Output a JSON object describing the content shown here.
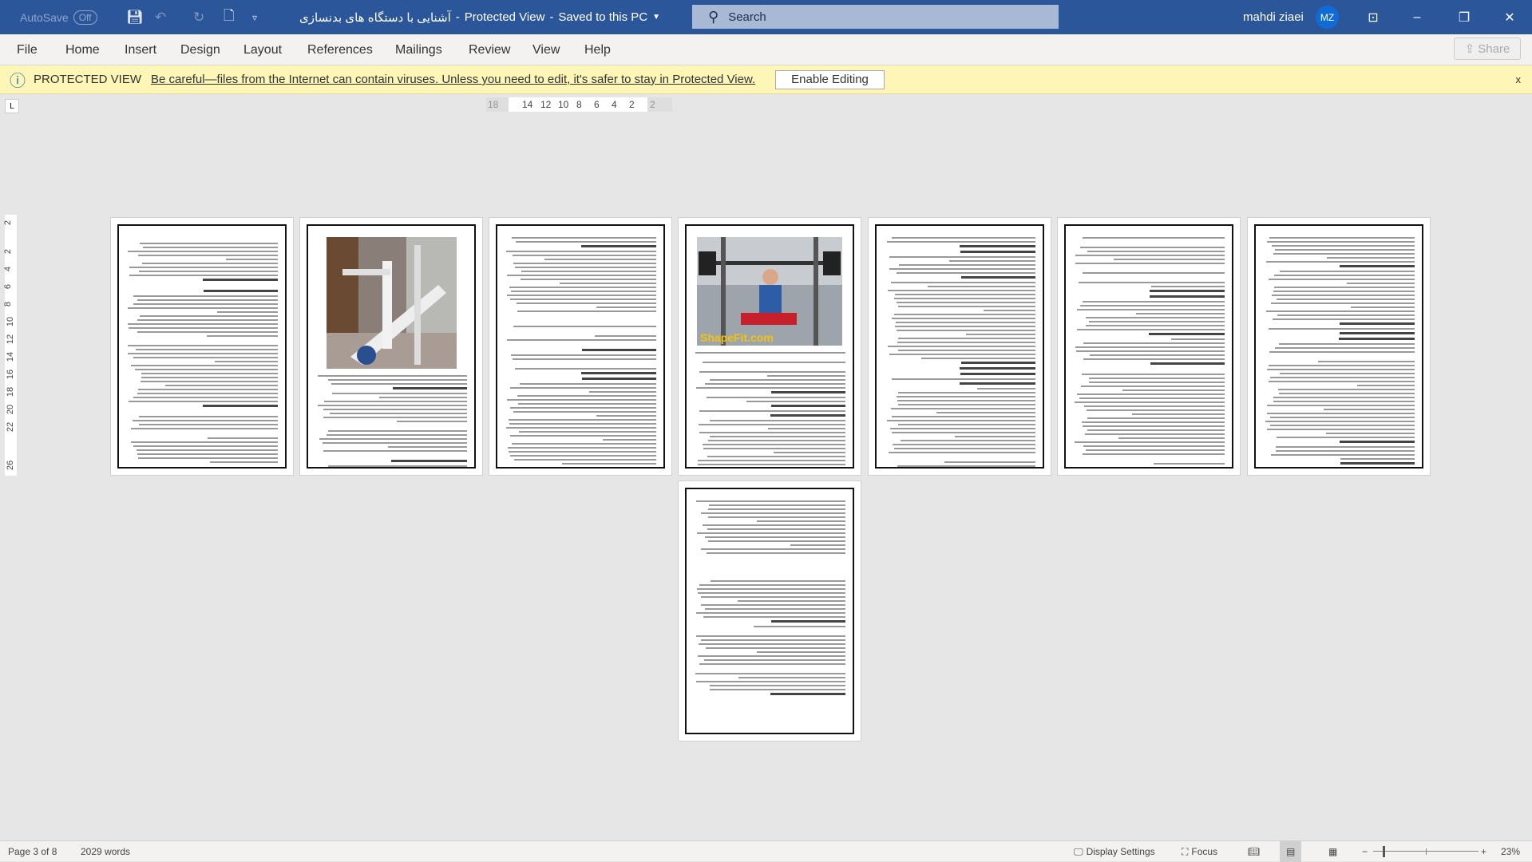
{
  "titlebar": {
    "autosave_label": "AutoSave",
    "autosave_state": "Off",
    "document_title": "آشنایی با دستگاه های بدنسازی",
    "mode": "Protected View",
    "save_status": "Saved to this PC",
    "search_placeholder": "Search",
    "user_name": "mahdi ziaei",
    "user_initials": "MZ"
  },
  "ribbon": {
    "tabs": [
      "File",
      "Home",
      "Insert",
      "Design",
      "Layout",
      "References",
      "Mailings",
      "Review",
      "View",
      "Help"
    ],
    "share_label": "Share"
  },
  "protected_view": {
    "label": "PROTECTED VIEW",
    "message": "Be careful—files from the Internet can contain viruses. Unless you need to edit, it's safer to stay in Protected View.",
    "enable_button": "Enable Editing",
    "close": "x"
  },
  "ruler": {
    "horizontal_marks": [
      "18",
      "14",
      "12",
      "10",
      "8",
      "6",
      "4",
      "2",
      "2"
    ],
    "vertical_marks": [
      "2",
      "2",
      "4",
      "6",
      "8",
      "10",
      "12",
      "14",
      "16",
      "18",
      "20",
      "22",
      "26"
    ]
  },
  "image_labels": {
    "page4_watermark": "ShapeFit.com"
  },
  "status": {
    "page": "Page 3 of 8",
    "words": "2029 words",
    "display_settings": "Display Settings",
    "focus": "Focus",
    "zoom": "23%"
  },
  "colors": {
    "titlebar": "#2b579a",
    "protected_bar": "#fdf6b7",
    "avatar": "#0f6cd6"
  }
}
